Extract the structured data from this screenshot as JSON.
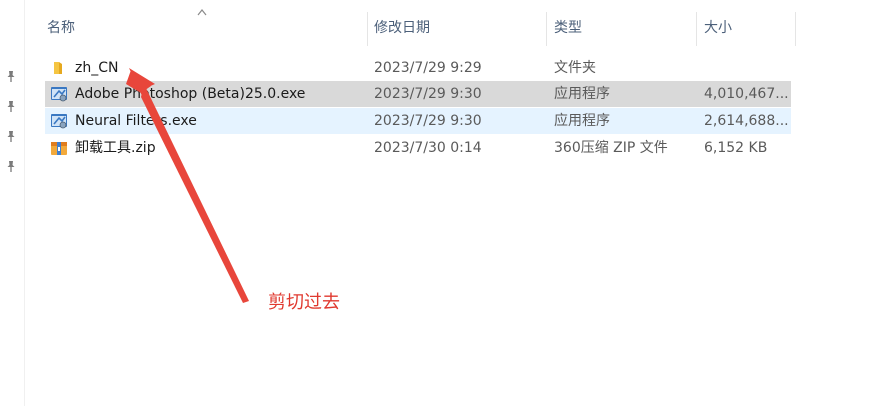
{
  "columns": {
    "name": "名称",
    "date": "修改日期",
    "type": "类型",
    "size": "大小"
  },
  "files": [
    {
      "name": "zh_CN",
      "date": "2023/7/29 9:29",
      "type": "文件夹",
      "size": "",
      "icon": "folder-icon"
    },
    {
      "name": "Adobe Photoshop (Beta)25.0.exe",
      "date": "2023/7/29 9:30",
      "type": "应用程序",
      "size": "4,010,467...",
      "icon": "exe-icon"
    },
    {
      "name": "Neural Filters.exe",
      "date": "2023/7/29 9:30",
      "type": "应用程序",
      "size": "2,614,688...",
      "icon": "exe-icon"
    },
    {
      "name": "卸载工具.zip",
      "date": "2023/7/30 0:14",
      "type": "360压缩 ZIP 文件",
      "size": "6,152 KB",
      "icon": "zip-archive-icon"
    }
  ],
  "annotation": {
    "text": "剪切过去",
    "color": "#e0392f"
  },
  "colors": {
    "selected_row": "#d9d9d9",
    "hover_row": "#e5f3ff",
    "header_text": "#4c607a"
  }
}
